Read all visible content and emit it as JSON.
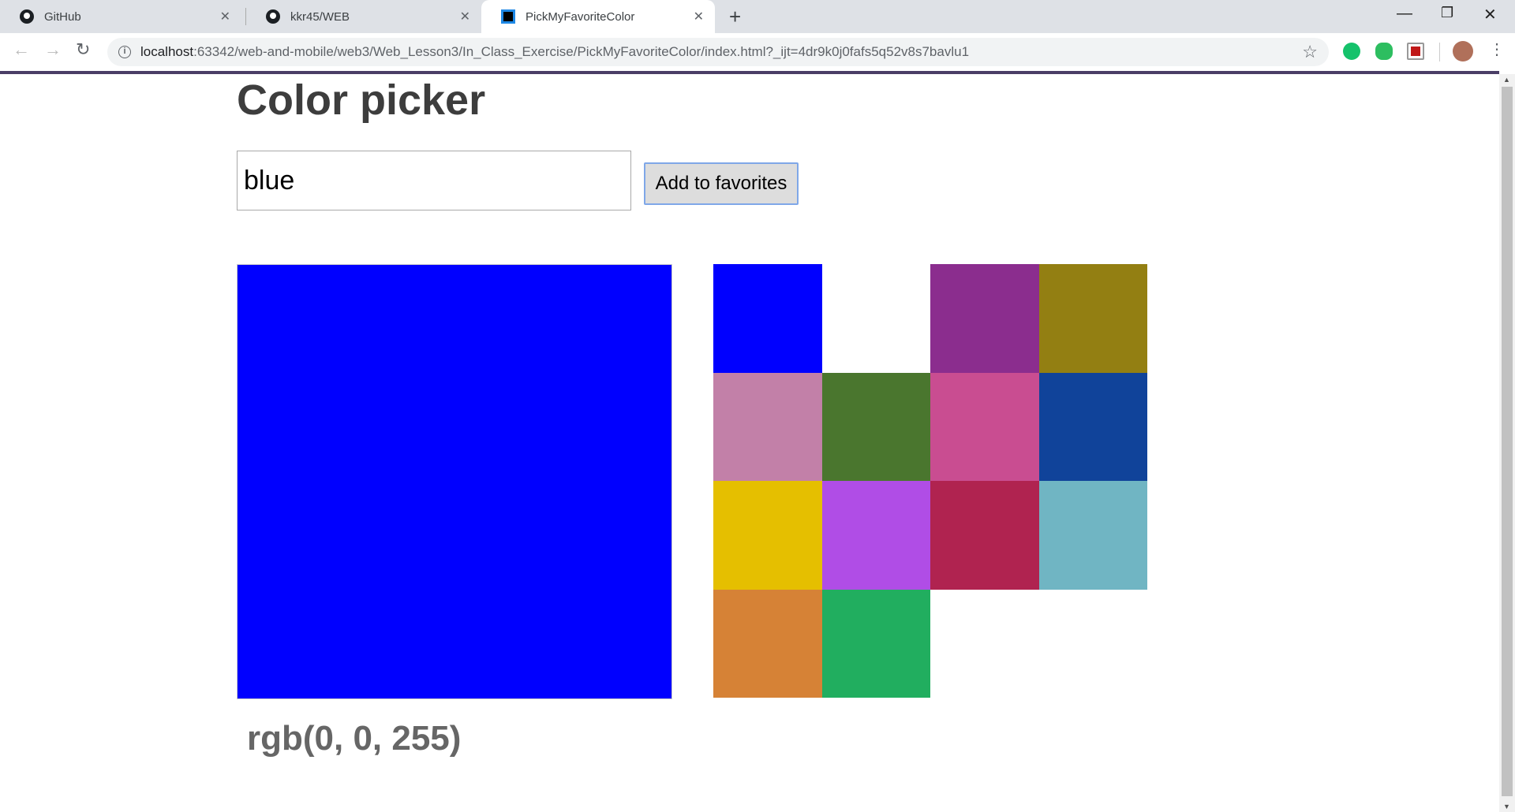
{
  "browser": {
    "tabs": [
      {
        "label": "GitHub",
        "icon": "github-icon"
      },
      {
        "label": "kkr45/WEB",
        "icon": "github-icon"
      },
      {
        "label": "PickMyFavoriteColor",
        "icon": "webstorm-icon",
        "active": true
      }
    ],
    "url_host": "localhost",
    "url_rest": ":63342/web-and-mobile/web3/Web_Lesson3/In_Class_Exercise/PickMyFavoriteColor/index.html?_ijt=4dr9k0j0fafs5q52v8s7bavlu1"
  },
  "page": {
    "title": "Color picker",
    "color_input_value": "blue",
    "add_button_label": "Add to favorites",
    "current_color": "#0000ff",
    "rgb_label": "rgb(0, 0, 255)",
    "favorites": [
      "#0000ff",
      "",
      "#8b2d8e",
      "#937f12",
      "#c280a8",
      "#4a762e",
      "#c94d91",
      "#10439a",
      "#e5bf00",
      "#b04de6",
      "#b02350",
      "#70b5c3",
      "#d68236",
      "#21ae5f"
    ]
  }
}
